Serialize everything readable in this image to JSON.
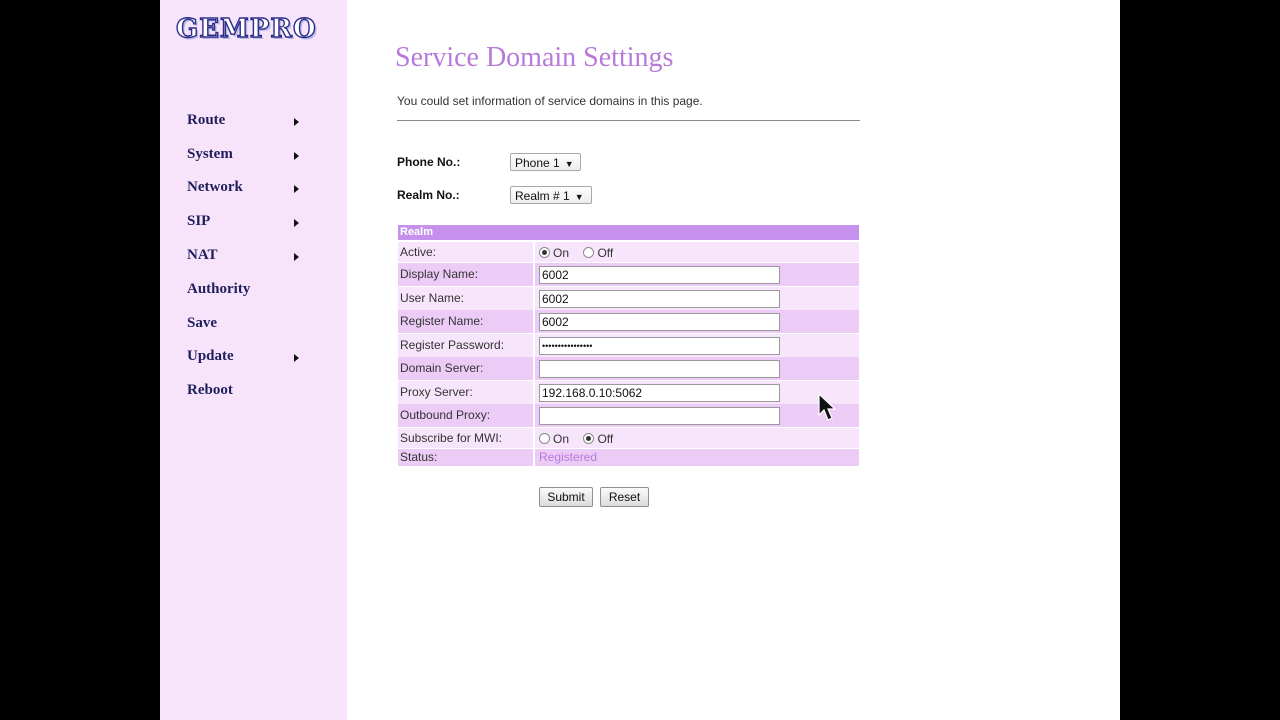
{
  "sidebar": {
    "logo": "GEMPRO",
    "items": [
      {
        "label": "Route",
        "has_submenu": true
      },
      {
        "label": "System",
        "has_submenu": true
      },
      {
        "label": "Network",
        "has_submenu": true
      },
      {
        "label": "SIP",
        "has_submenu": true
      },
      {
        "label": "NAT",
        "has_submenu": true
      },
      {
        "label": "Authority",
        "has_submenu": false
      },
      {
        "label": "Save",
        "has_submenu": false
      },
      {
        "label": "Update",
        "has_submenu": true
      },
      {
        "label": "Reboot",
        "has_submenu": false
      }
    ]
  },
  "main": {
    "title": "Service Domain Settings",
    "description": "You could set information of service domains in this page.",
    "phone": {
      "label": "Phone No.:",
      "value": "Phone 1"
    },
    "realm": {
      "label": "Realm No.:",
      "value": "Realm # 1"
    },
    "table": {
      "header": "Realm",
      "active": {
        "label": "Active:",
        "on": "On",
        "off": "Off",
        "selected": "On"
      },
      "display_name": {
        "label": "Display Name:",
        "value": "6002"
      },
      "user_name": {
        "label": "User Name:",
        "value": "6002"
      },
      "register_name": {
        "label": "Register Name:",
        "value": "6002"
      },
      "register_password": {
        "label": "Register Password:",
        "value": "••••••••••••••••"
      },
      "domain_server": {
        "label": "Domain Server:",
        "value": ""
      },
      "proxy_server": {
        "label": "Proxy Server:",
        "value": "192.168.0.10:5062"
      },
      "outbound_proxy": {
        "label": "Outbound Proxy:",
        "value": ""
      },
      "mwi": {
        "label": "Subscribe for MWI:",
        "on": "On",
        "off": "Off",
        "selected": "Off"
      },
      "status": {
        "label": "Status:",
        "value": "Registered"
      }
    },
    "buttons": {
      "submit": "Submit",
      "reset": "Reset"
    }
  },
  "colors": {
    "sidebar_bg": "#f7e4fb",
    "title": "#b87ad8",
    "table_header": "#c591ec",
    "row_dark": "#ecccf6",
    "row_light": "#f7e6fb",
    "status_text": "#b87ad8"
  }
}
